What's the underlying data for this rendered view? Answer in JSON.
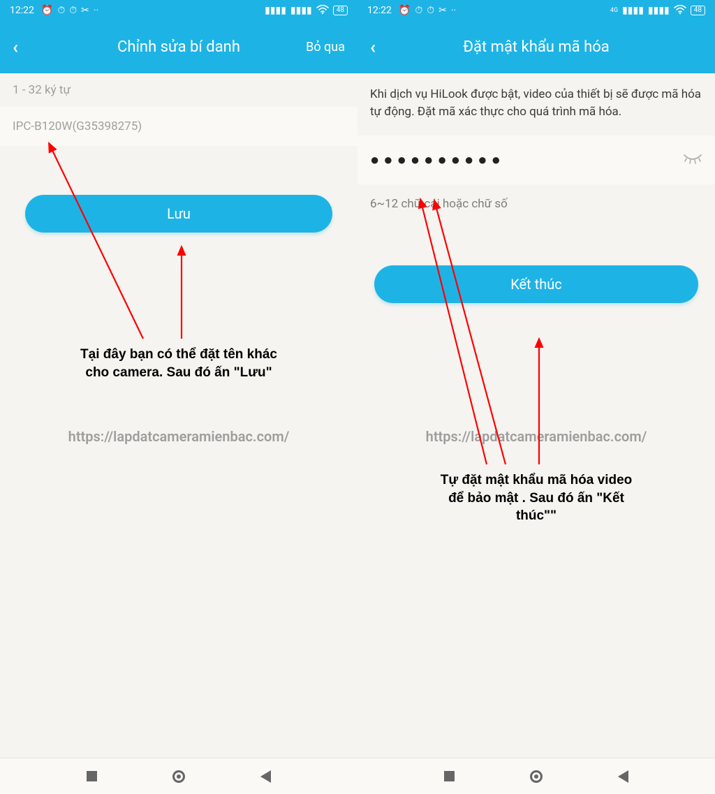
{
  "status_bar": {
    "time": "12:22",
    "battery": "48",
    "lte_label": "4G"
  },
  "left": {
    "title": "Chỉnh sửa bí danh",
    "skip": "Bỏ qua",
    "hint": "1 - 32 ký tự",
    "input_value": "IPC-B120W(G35398275)",
    "save_label": "Lưu",
    "annotation": "Tại đây bạn có thể đặt tên khác\ncho camera. Sau đó ấn \"Lưu\"",
    "watermark": "https://lapdatcameramienbac.com/"
  },
  "right": {
    "title": "Đặt mật khẩu mã hóa",
    "description": "Khi dịch vụ HiLook được bật, video của thiết bị sẽ được mã hóa tự động. Đặt mã xác thực cho quá trình mã hóa.",
    "password_dots": "●●●●●●●●●●",
    "sub_hint": "6~12 chữ cái hoặc chữ số",
    "finish_label": "Kết thúc",
    "annotation": "Tự đặt mật khẩu mã hóa video\nđể bảo mật . Sau đó ấn \"Kết\nthúc\"\"",
    "watermark": "https://lapdatcameramienbac.com/"
  }
}
